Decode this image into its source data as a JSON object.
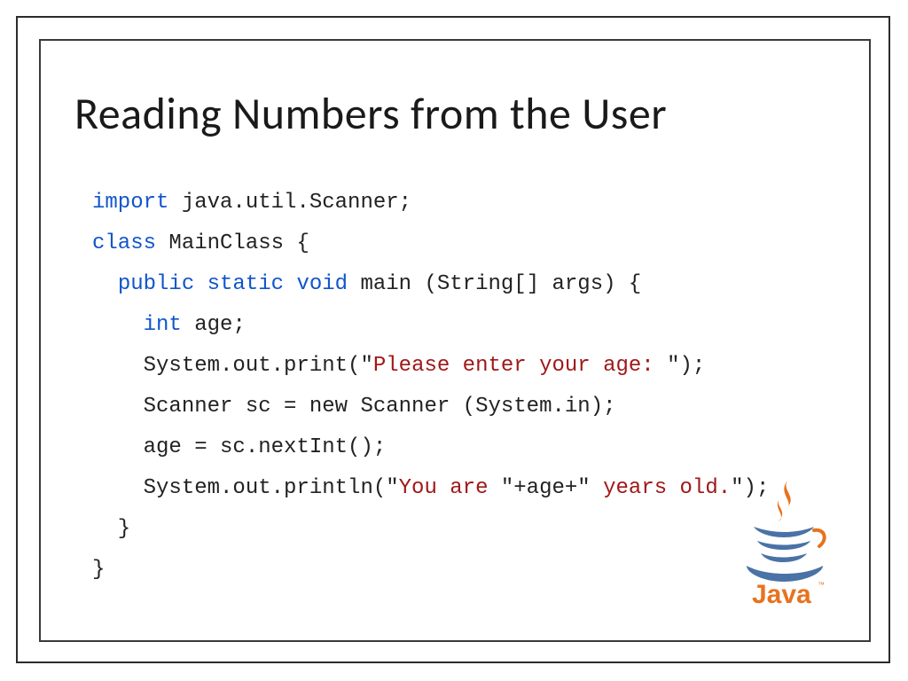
{
  "title": "Reading Numbers from the User",
  "code": {
    "l1_kw": "import",
    "l1_rest": " java.util.Scanner;",
    "l2_kw": "class",
    "l2_rest": " MainClass {",
    "l3_pre": "  ",
    "l3_kw": "public static void",
    "l3_rest": " main (String[] args) {",
    "l4_pre": "    ",
    "l4_kw": "int",
    "l4_rest": " age;",
    "l5_pre": "    System.out.print(\"",
    "l5_str": "Please enter your age: ",
    "l5_post": "\");",
    "l6": "    Scanner sc = new Scanner (System.in);",
    "l7": "    age = sc.nextInt();",
    "l8_pre": "    System.out.println(\"",
    "l8_s1": "You are ",
    "l8_mid": "\"+age+\"",
    "l8_s2": " years old.",
    "l8_post": "\");",
    "l9": "  }",
    "l10": "}"
  },
  "logo": {
    "word": "Java",
    "tm": "™"
  }
}
